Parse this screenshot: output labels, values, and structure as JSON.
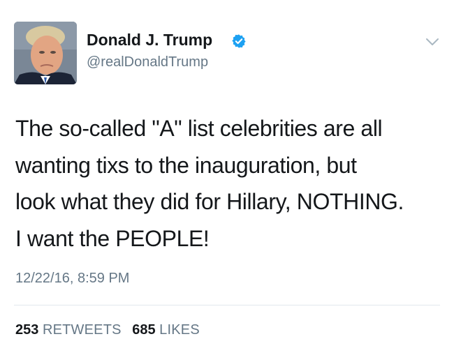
{
  "header": {
    "display_name": "Donald J. Trump",
    "handle": "@realDonaldTrump",
    "verified_icon": "verified-badge-icon",
    "menu_icon": "chevron-down-icon"
  },
  "tweet": {
    "lines": [
      "The so-called \"A\" list celebrities are all",
      "wanting tixs to the inauguration, but",
      "look what they did for Hillary, NOTHING.",
      "I want the PEOPLE!"
    ],
    "timestamp": "12/22/16, 8:59 PM"
  },
  "stats": {
    "retweets_count": "253",
    "retweets_label": "RETWEETS",
    "likes_count": "685",
    "likes_label": "LIKES"
  },
  "colors": {
    "verified": "#1da1f2",
    "secondary_text": "#657786",
    "primary_text": "#14171a",
    "divider": "#e1e8ed"
  }
}
